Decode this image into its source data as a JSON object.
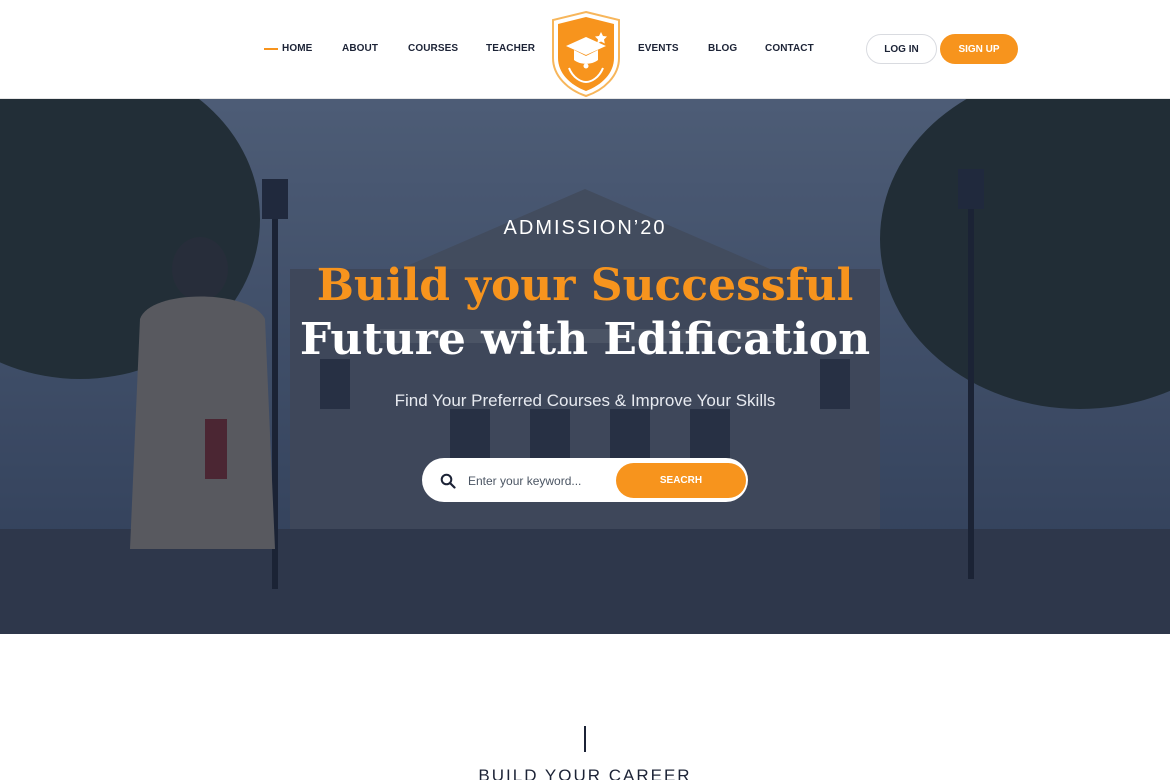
{
  "nav": {
    "left": [
      {
        "label": "HOME",
        "active": true
      },
      {
        "label": "ABOUT"
      },
      {
        "label": "COURSES"
      },
      {
        "label": "TEACHER"
      }
    ],
    "right": [
      {
        "label": "EVENTS"
      },
      {
        "label": "BLOG"
      },
      {
        "label": "CONTACT"
      }
    ],
    "login_label": "LOG IN",
    "signup_label": "SIGN UP",
    "logo_icon": "graduation-shield-logo"
  },
  "hero": {
    "kicker": "ADMISSION’20",
    "title_line1": "Build your Successful",
    "title_line2": "Future with Edification",
    "subtitle": "Find Your Preferred Courses & Improve Your Skills",
    "search_placeholder": "Enter your keyword...",
    "search_button": "SEACRH"
  },
  "section": {
    "kicker": "BUILD YOUR CAREER"
  },
  "colors": {
    "accent": "#f7941d",
    "navy": "#1c2336",
    "hero_overlay": "#18223a"
  }
}
